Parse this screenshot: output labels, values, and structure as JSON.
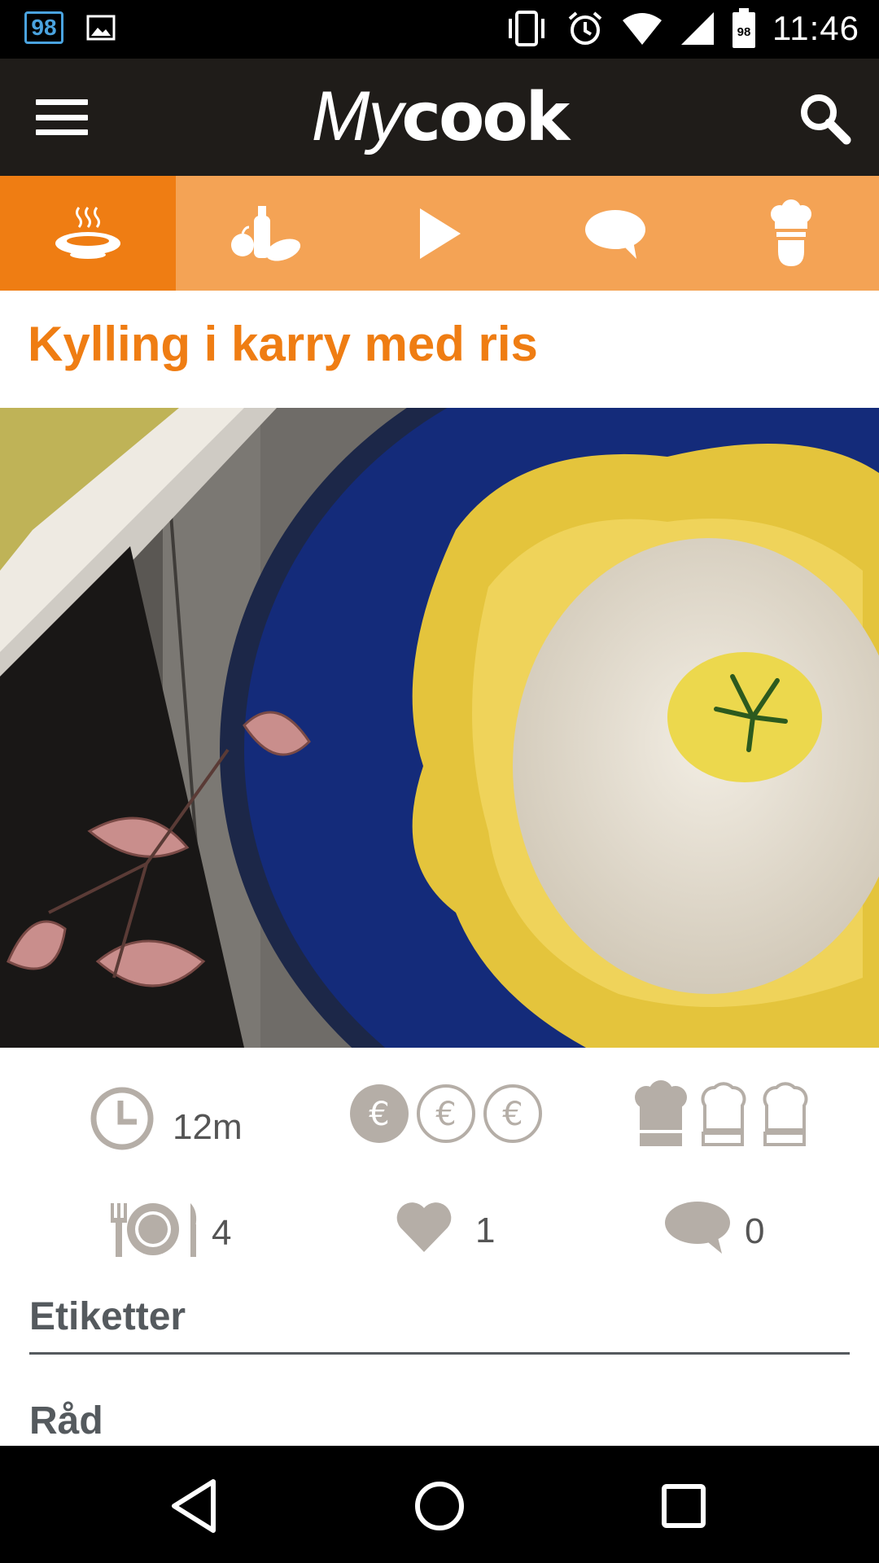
{
  "status_bar": {
    "notification_badge": "98",
    "battery_level": "98",
    "time": "11:46",
    "icons": [
      "notification-98-icon",
      "image-icon",
      "vibrate-icon",
      "alarm-icon",
      "wifi-icon",
      "signal-icon",
      "battery-icon"
    ]
  },
  "app_bar": {
    "brand_my": "My",
    "brand_cook": "cook",
    "menu_icon": "hamburger-menu-icon",
    "search_icon": "search-icon"
  },
  "tabs": [
    {
      "icon": "steaming-plate-icon",
      "active": true
    },
    {
      "icon": "ingredients-icon",
      "active": false
    },
    {
      "icon": "play-icon",
      "active": false
    },
    {
      "icon": "comment-icon",
      "active": false
    },
    {
      "icon": "chef-hat-icon",
      "active": false
    }
  ],
  "recipe": {
    "title": "Kylling i karry med ris",
    "time": "12m",
    "cost_level": 1,
    "cost_max": 3,
    "difficulty_level": 1,
    "difficulty_max": 3,
    "servings": "4",
    "likes": "1",
    "comments": "0"
  },
  "sections": {
    "tags_heading": "Etiketter",
    "tips_heading": "Råd"
  },
  "colors": {
    "accent": "#ef7d13",
    "tab_bar": "#f4a355",
    "app_bar": "#1f1c19",
    "stat_icon": "#b5aea7"
  }
}
